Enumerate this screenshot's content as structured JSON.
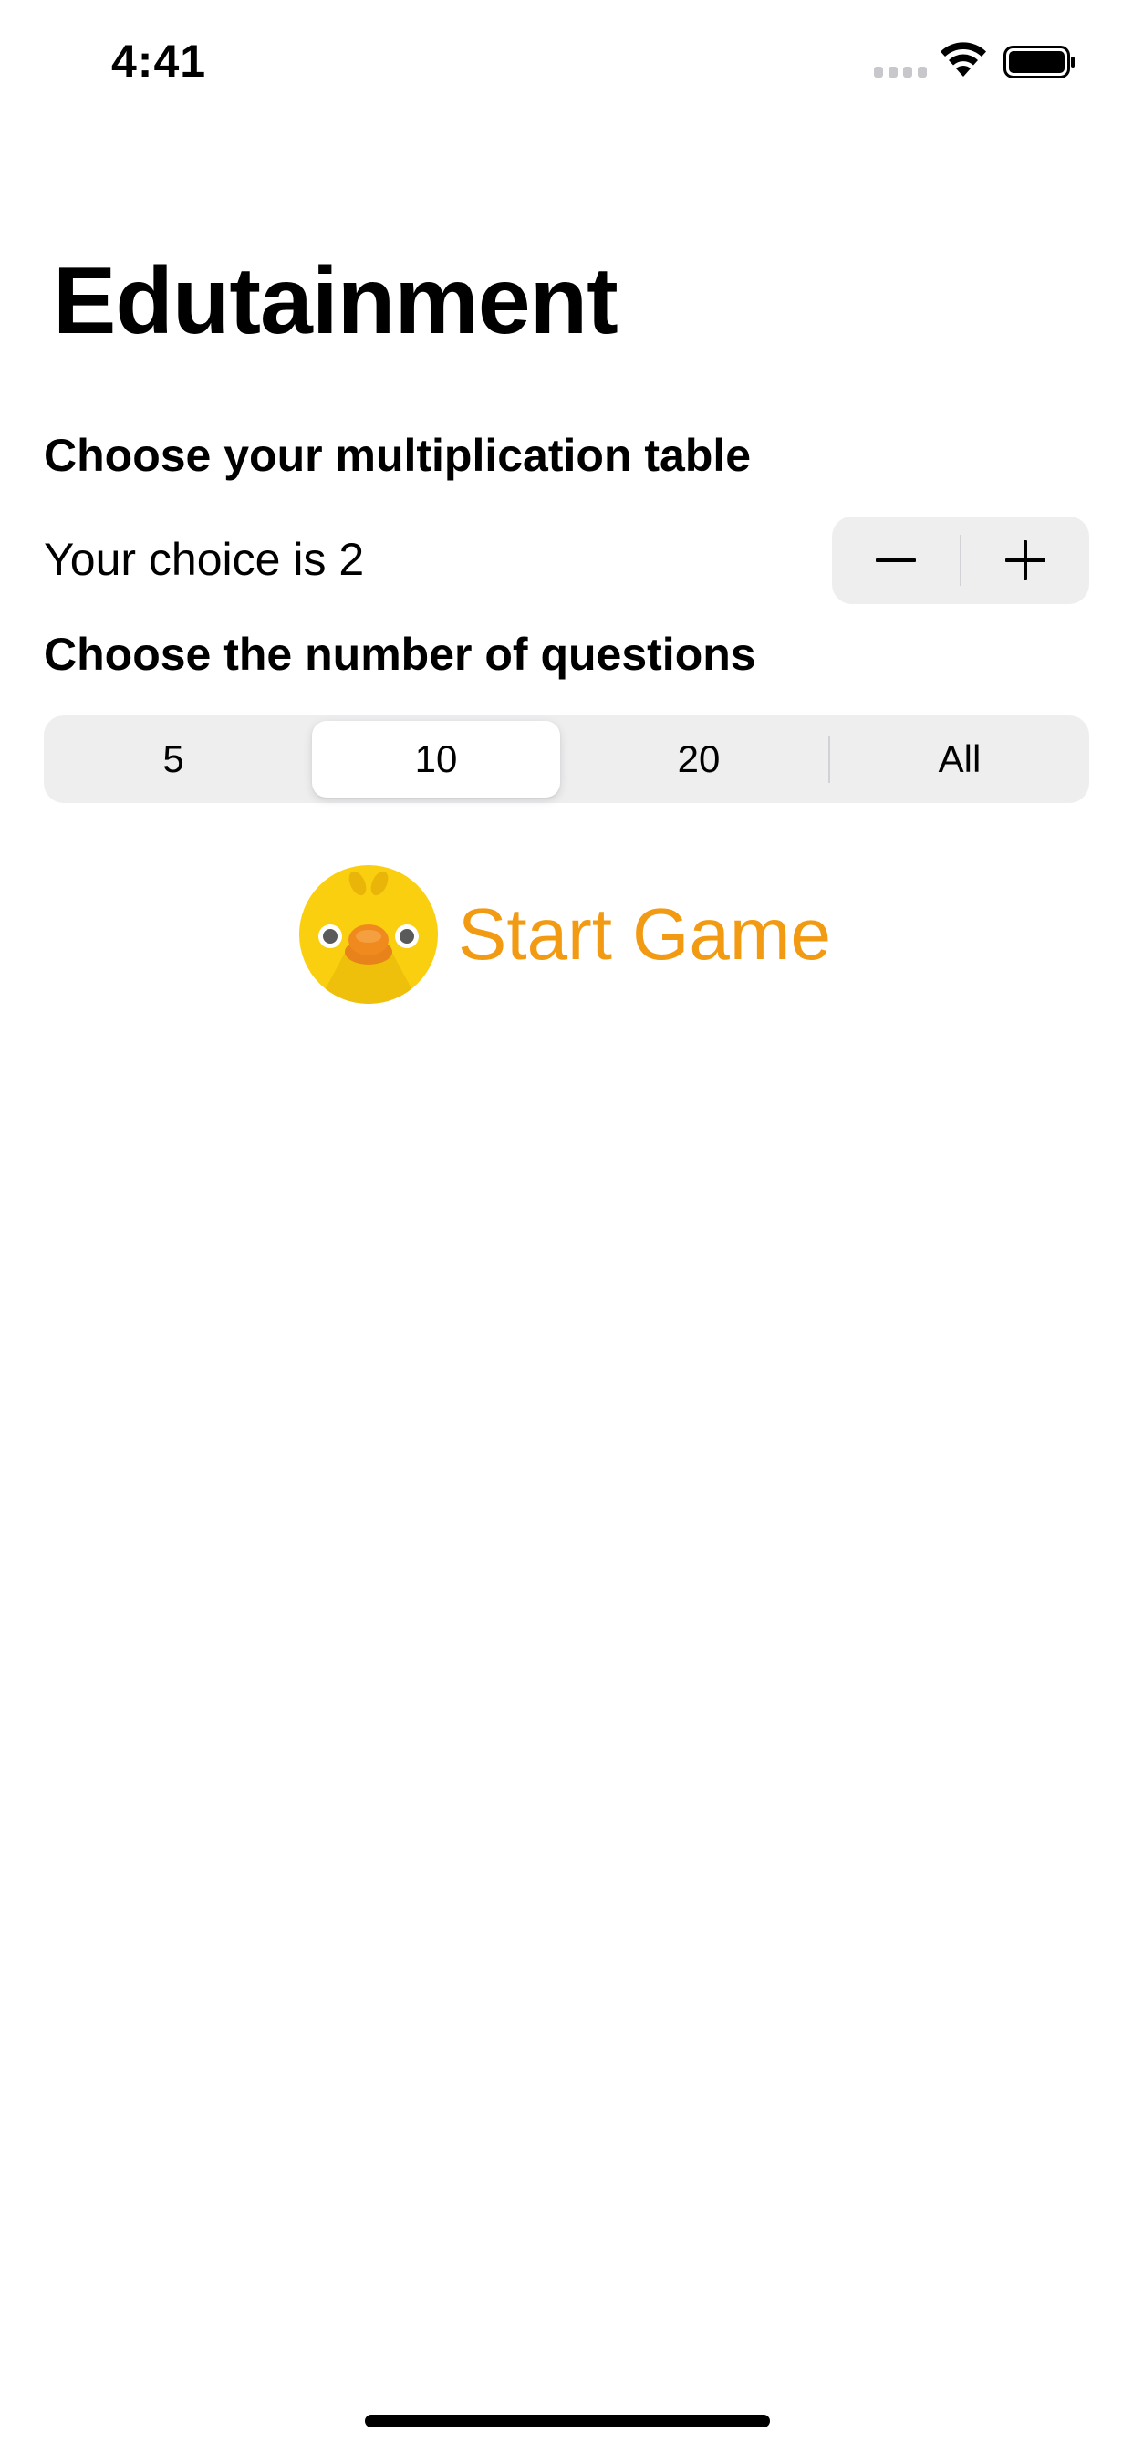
{
  "status_bar": {
    "time": "4:41",
    "signal_icon": "cellular-signal-icon",
    "wifi_icon": "wifi-icon",
    "battery_icon": "battery-icon"
  },
  "title": "Edutainment",
  "table_section": {
    "label": "Choose your multiplication table",
    "choice_text": "Your choice is 2",
    "stepper": {
      "minus_icon": "minus-icon",
      "plus_icon": "plus-icon"
    }
  },
  "questions_section": {
    "label": "Choose the number of questions",
    "options": [
      "5",
      "10",
      "20",
      "All"
    ],
    "selected": "10"
  },
  "start_button": {
    "label": "Start Game",
    "icon": "chick-icon",
    "color": "#f29a12"
  }
}
